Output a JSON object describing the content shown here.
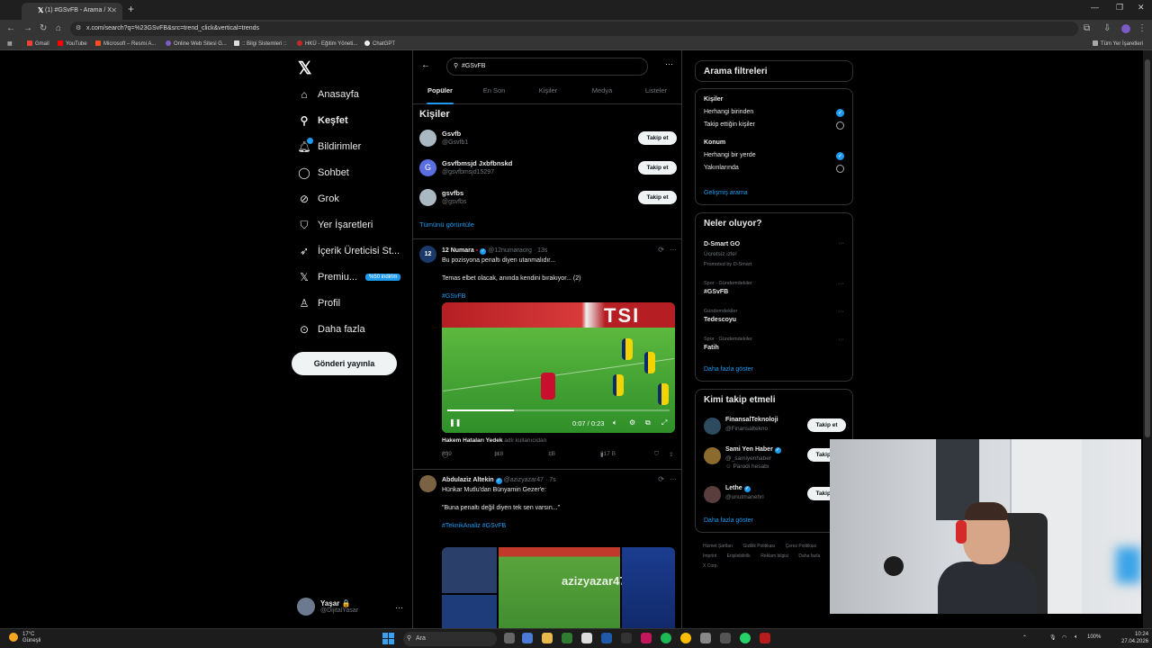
{
  "browser": {
    "tab_title": "(1) #GSvFB - Arama / X",
    "url": "x.com/search?q=%23GSvFB&src=trend_click&vertical=trends",
    "bookmarks": [
      "Gmail",
      "YouTube",
      "Microsoft – Resmi A...",
      "Online Web Sitesi G...",
      ":: Bilgi Sistemleri ::",
      "HKÜ - Eğitim Yöneti...",
      "ChatGPT"
    ],
    "all_bookmarks": "Tüm Yer İşaretleri"
  },
  "nav": {
    "items": [
      "Anasayfa",
      "Keşfet",
      "Bildirimler",
      "Sohbet",
      "Grok",
      "Yer İşaretleri",
      "İçerik Üreticisi St...",
      "Premiu...",
      "Profil",
      "Daha fazla"
    ],
    "premium_badge": "%50 indirim",
    "post_button": "Gönderi yayınla",
    "account_name": "Yaşar 🔒",
    "account_handle": "@DijitalYasar"
  },
  "search": {
    "query": "#GSvFB",
    "tabs": [
      "Popüler",
      "En Son",
      "Kişiler",
      "Medya",
      "Listeler"
    ]
  },
  "people": {
    "title": "Kişiler",
    "list": [
      {
        "name": "Gsvfb",
        "handle": "@Gsvfb1",
        "avatar": ""
      },
      {
        "name": "Gsvfbmsjd Jxbfbnskd",
        "handle": "@gsvfbmsjd15297",
        "avatar": "G"
      },
      {
        "name": "gsvfbs",
        "handle": "@gsvfbs",
        "avatar": ""
      }
    ],
    "follow_label": "Takip et",
    "show_all": "Tümünü görüntüle"
  },
  "tweet1": {
    "avatar": "12",
    "name": "12 Numara",
    "meta": "@12numaraorg · 13s",
    "line1": "Bu pozisyona penaltı diyen utanmalıdır...",
    "line2": "Temas elbet olacak, anında kendini bırakıyor... (2)",
    "hashtag": "#GSvFB",
    "video_time": "0:07 / 0:23",
    "video_banner": "TSI",
    "video_progress": 0.3,
    "context_name": "Hakem Hataları Yedek",
    "context_suffix": "adlı kullanıcıdan",
    "replies": "809",
    "reposts": "118",
    "likes": "1B",
    "views": "317 B"
  },
  "tweet2": {
    "name": "Abdulaziz Altekin",
    "meta": "@azizyazar47 · 7s",
    "line1": "Hünkar Mutlu'dan Bünyamin Gezer'e:",
    "line2": "\"Buna penaltı değil diyen tek sen varsın...\"",
    "hashtags": "#TeknikAnaliz #GSvFB",
    "watermark": "azizyazar47"
  },
  "filters": {
    "title": "Arama filtreleri",
    "people_label": "Kişiler",
    "people_opts": [
      "Herhangi birinden",
      "Takip ettiğin kişiler"
    ],
    "location_label": "Konum",
    "location_opts": [
      "Herhangi bir yerde",
      "Yakınlarında"
    ],
    "advanced": "Gelişmiş arama"
  },
  "trends": {
    "title": "Neler oluyor?",
    "promo_name": "D-Smart GO",
    "promo_sub": "Ücretsiz izle!",
    "promo_by": "Promoted by D-Smart",
    "items": [
      {
        "cat": "Spor · Gündemdekiler",
        "name": "#GSvFB"
      },
      {
        "cat": "Gündemdekiler",
        "name": "Tedescoyu"
      },
      {
        "cat": "Spor · Gündemdekiler",
        "name": "Fatih"
      }
    ],
    "more": "Daha fazla göster"
  },
  "who_to_follow": {
    "title": "Kimi takip etmeli",
    "list": [
      {
        "name": "FinansalTeknoloji",
        "handle": "@Finansaltekno",
        "extra": ""
      },
      {
        "name": "Sami Yen Haber",
        "handle": "@_samiyenhaber",
        "extra": "Parodi hesabı"
      },
      {
        "name": "Lethe",
        "handle": "@unutmanehri",
        "extra": ""
      }
    ],
    "follow_label": "Takip et",
    "more": "Daha fazla göster"
  },
  "footer": [
    "Hizmet Şartları",
    "Gizlilik Politikası",
    "Çerez Politikası",
    "Imprint",
    "Erişilebilirlik",
    "Reklam bilgisi",
    "Daha fazla",
    "© 2026 X Corp."
  ],
  "taskbar": {
    "temp": "17°C",
    "weather": "Güneşli",
    "search": "Ara",
    "time": "10:24",
    "date": "27.04.2026",
    "battery": "100%"
  },
  "colors": {
    "accent": "#1d9bf0",
    "background": "#000000",
    "border": "#2f3336"
  }
}
